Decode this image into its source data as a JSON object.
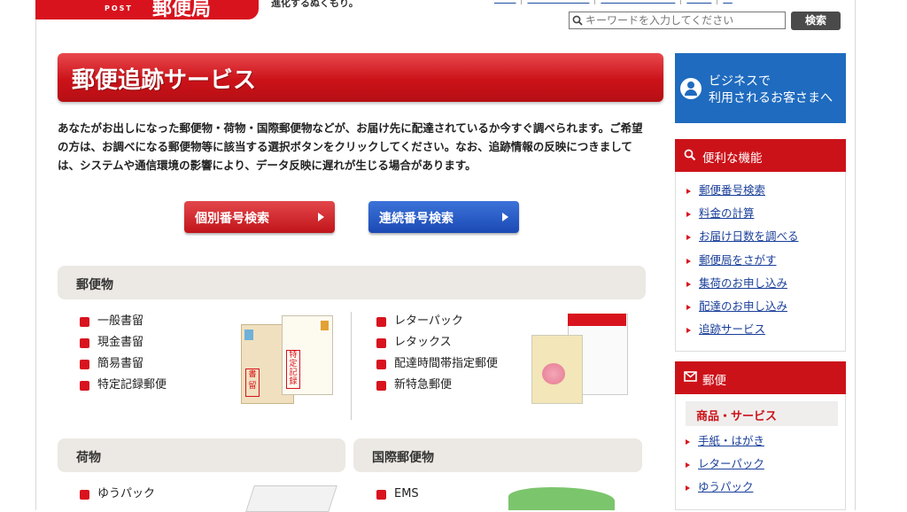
{
  "header": {
    "logo_post": "POST",
    "logo_text": "郵便局",
    "tagline": "進化するぬくもり。",
    "search_placeholder": "キーワードを入力してください",
    "search_button": "検索"
  },
  "main": {
    "title": "郵便追跡サービス",
    "intro": "あなたがお出しになった郵便物・荷物・国際郵便物などが、お届け先に配達されているか今すぐ調べられます。ご希望の方は、お調べになる郵便物等に該当する選択ボタンをクリックしてください。なお、追跡情報の反映につきましては、システムや通信環境の影響により、データ反映に遅れが生じる場合があります。",
    "btn_individual": "個別番号検索",
    "btn_continuous": "連続番号検索",
    "sections": {
      "mail": {
        "title": "郵便物",
        "items_left": [
          "一般書留",
          "現金書留",
          "簡易書留",
          "特定記録郵便"
        ],
        "items_right": [
          "レターパック",
          "レタックス",
          "配達時間帯指定郵便",
          "新特急郵便"
        ]
      },
      "parcel": {
        "title": "荷物",
        "items": [
          "ゆうパック"
        ]
      },
      "intl": {
        "title": "国際郵便物",
        "items": [
          "EMS"
        ]
      }
    },
    "illustration": {
      "envelope1_label": "書留",
      "envelope2_label": "特定記録"
    }
  },
  "sidebar": {
    "business_line1": "ビジネスで",
    "business_line2": "利用されるお客さまへ",
    "features_title": "便利な機能",
    "features": [
      "郵便番号検索",
      "料金の計算",
      "お届け日数を調べる",
      "郵便局をさがす",
      "集荷のお申し込み",
      "配達のお申し込み",
      "追跡サービス"
    ],
    "mail_title": "郵便",
    "mail_sub_title": "商品・サービス",
    "mail_items": [
      "手紙・はがき",
      "レターパック",
      "ゆうパック"
    ]
  },
  "colors": {
    "brand_red": "#cc1219",
    "brand_blue": "#1f6bbf",
    "link_blue": "#1a3f99"
  }
}
